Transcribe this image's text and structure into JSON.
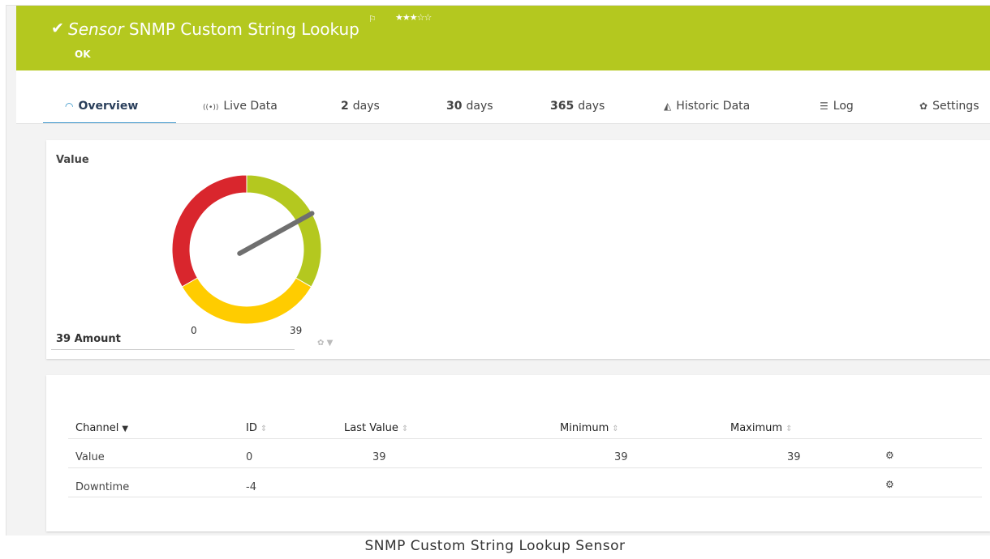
{
  "header": {
    "sensor_kind": "Sensor",
    "sensor_name": "SNMP Custom String Lookup",
    "status": "OK",
    "stars": "★★★☆☆",
    "bg_color": "#b4c81f"
  },
  "tabs": [
    {
      "icon": "gauge-icon",
      "glyph": "◠",
      "label": "Overview",
      "active": true
    },
    {
      "icon": "live-data-icon",
      "glyph": "((•))",
      "label": "Live Data"
    },
    {
      "num": "2",
      "label": "days"
    },
    {
      "num": "30",
      "label": "days"
    },
    {
      "num": "365",
      "label": "days"
    },
    {
      "icon": "area-chart-icon",
      "glyph": "◭",
      "label": "Historic Data"
    },
    {
      "icon": "log-icon",
      "glyph": "☰",
      "label": "Log"
    },
    {
      "icon": "gear-icon",
      "glyph": "✿",
      "label": "Settings"
    }
  ],
  "gauge": {
    "title": "Value",
    "amount_label": "39 Amount",
    "min": "0",
    "max": "39",
    "value": 39,
    "colors": {
      "red": "#d9262d",
      "yellow": "#ffcc00",
      "green": "#b4c81f",
      "needle": "#6f6f6f"
    }
  },
  "table": {
    "headers": {
      "channel": "Channel",
      "id": "ID",
      "last_value": "Last Value",
      "minimum": "Minimum",
      "maximum": "Maximum"
    },
    "rows": [
      {
        "channel": "Value",
        "id": "0",
        "last_value": "39",
        "minimum": "39",
        "maximum": "39"
      },
      {
        "channel": "Downtime",
        "id": "-4",
        "last_value": "",
        "minimum": "",
        "maximum": ""
      }
    ]
  },
  "caption": "SNMP Custom String Lookup Sensor"
}
